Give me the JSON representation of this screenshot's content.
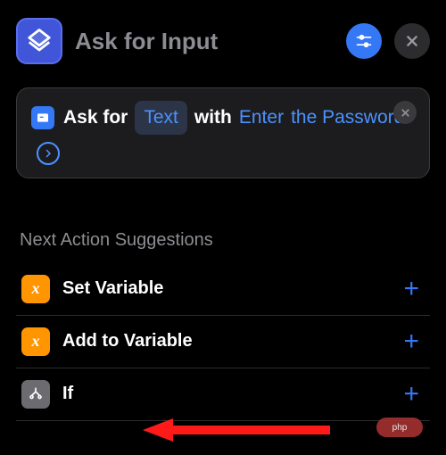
{
  "header": {
    "title": "Ask for Input"
  },
  "action_card": {
    "icon_name": "ask-icon",
    "text_prefix": "Ask for",
    "token_type": "Text",
    "text_mid": "with",
    "prompt_part1": "Enter",
    "prompt_part2": "the Password"
  },
  "suggestions": {
    "title": "Next Action Suggestions",
    "items": [
      {
        "icon_text": "x",
        "icon_class": "orange",
        "label": "Set Variable"
      },
      {
        "icon_text": "x",
        "icon_class": "orange",
        "label": "Add to Variable"
      },
      {
        "icon_text": "",
        "icon_class": "gray",
        "label": "If"
      }
    ]
  },
  "watermark": "php"
}
